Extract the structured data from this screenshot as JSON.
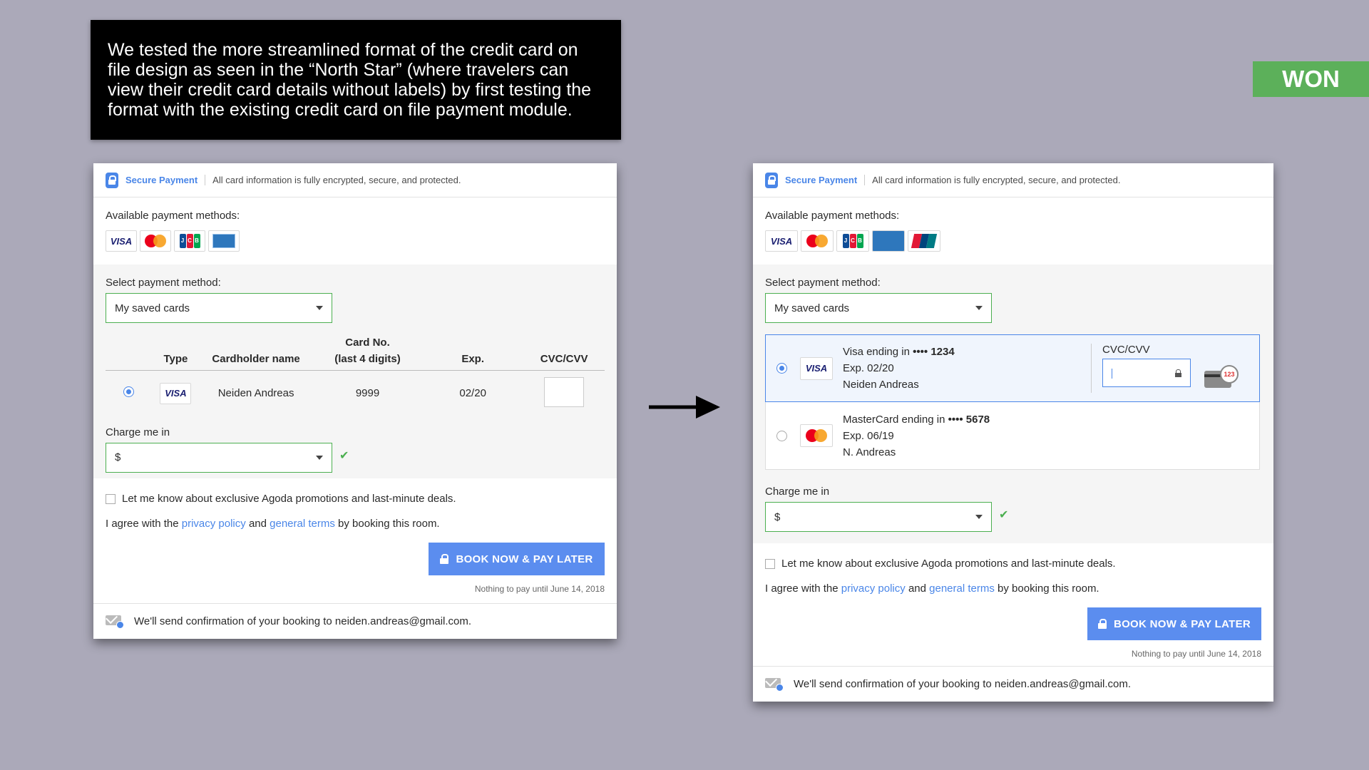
{
  "note": "We tested the more streamlined format of the credit card on file design as seen in the “North Star” (where travelers can view their credit card details without labels) by first testing the format with the existing credit card on file payment module.",
  "won_label": "WON",
  "secure": {
    "title": "Secure Payment",
    "text": "All card information is fully encrypted, secure, and protected."
  },
  "available_label": "Available payment methods:",
  "select_label": "Select payment method:",
  "select_value": "My saved cards",
  "charge_label": "Charge me in",
  "charge_value": "$",
  "promo_text": "Let me know about exclusive Agoda promotions and last-minute deals.",
  "agree": {
    "prefix": "I agree with the",
    "privacy": "privacy policy",
    "and": "and",
    "terms": "general terms",
    "suffix": "by booking this room."
  },
  "book_button": "BOOK NOW & PAY LATER",
  "nothing_to_pay": "Nothing to pay until June 14, 2018",
  "confirmation": "We'll send confirmation of your booking to neiden.andreas@gmail.com.",
  "left_table": {
    "headers": [
      "Type",
      "Cardholder name",
      "Card No.",
      "(last 4 digits)",
      "Exp.",
      "CVC/CVV"
    ],
    "row": {
      "type": "VISA",
      "name": "Neiden Andreas",
      "digits": "9999",
      "exp": "02/20"
    }
  },
  "logos": {
    "visa": "VISA",
    "jcb": "JCB"
  },
  "saved_cards": [
    {
      "brand": "VISA",
      "line1": "Visa ending in",
      "masked": "•••• 1234",
      "exp": "Exp. 02/20",
      "name": "Neiden Andreas",
      "selected": true
    },
    {
      "brand": "mastercard",
      "line1": "MasterCard ending in",
      "masked": "•••• 5678",
      "exp": "Exp. 06/19",
      "name": "N. Andreas",
      "selected": false
    }
  ],
  "cvc_label": "CVC/CVV",
  "cvc_hint": "123",
  "icons": [
    "lock-icon",
    "mail-icon",
    "check-icon",
    "chevron-down-icon",
    "arrow-right-icon"
  ],
  "colors": {
    "accent": "#4a86e8",
    "success": "#4caf50",
    "won": "#5cb05a",
    "background": "#aba9b9"
  }
}
